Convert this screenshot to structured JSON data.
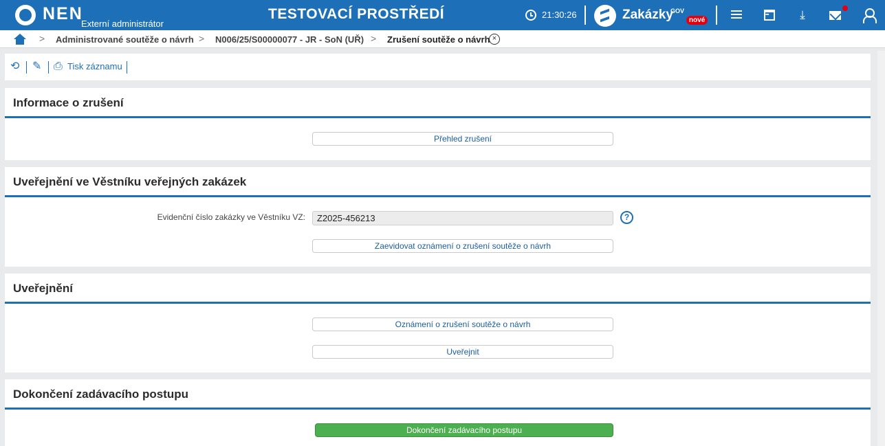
{
  "header": {
    "logo": "NEN",
    "role": "Externí administrátor",
    "environment": "TESTOVACÍ PROSTŘEDÍ",
    "time": "21:30:26",
    "zakazky": "Zakázky",
    "gov": "GOV",
    "badge": "nové"
  },
  "breadcrumb": {
    "items": [
      "Administrované soutěže o návrh",
      "N006/25/S00000077 - JR - SoN (UŘ)",
      "Zrušení soutěže o návrh"
    ],
    "separator": ">",
    "close": "×"
  },
  "toolbar": {
    "print_label": "Tisk záznamu"
  },
  "sections": {
    "info": {
      "title": "Informace o zrušení",
      "button": "Přehled zrušení"
    },
    "vestnik": {
      "title": "Uveřejnění ve Věstníku veřejných zakázek",
      "field_label": "Evidenční číslo zakázky ve Věstníku VZ:",
      "field_value": "Z2025-456213",
      "help": "?",
      "button": "Zaevidovat oznámení o zrušení soutěže o návrh"
    },
    "publish": {
      "title": "Uveřejnění",
      "button_notice": "Oznámení o zrušení soutěže o návrh",
      "button_publish": "Uveřejnit"
    },
    "finish": {
      "title": "Dokončení zadávacího postupu",
      "button": "Dokončení zadávacího postupu"
    }
  },
  "colors": {
    "brand": "#1d6fb8",
    "accent_green": "#4caf50",
    "badge_red": "#e3000f"
  }
}
